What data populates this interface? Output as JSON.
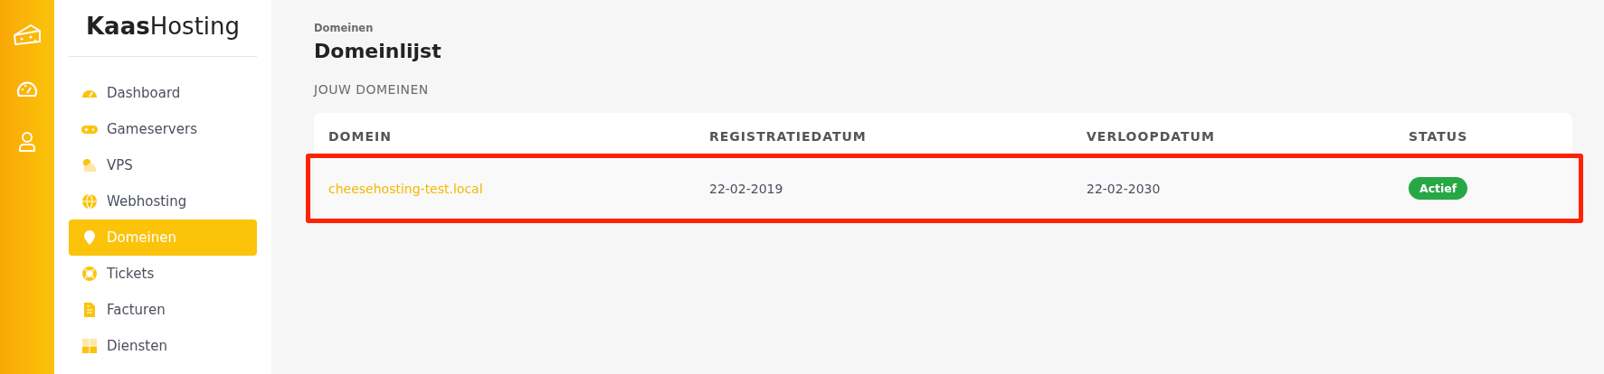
{
  "brand": {
    "bold": "Kaas",
    "light": "Hosting"
  },
  "rail": [
    {
      "kind": "cheese",
      "selected": false
    },
    {
      "kind": "gauge",
      "selected": false
    },
    {
      "kind": "user",
      "selected": false
    }
  ],
  "sidebar": {
    "items": [
      {
        "label": "Dashboard",
        "kind": "gauge",
        "selected": false
      },
      {
        "label": "Gameservers",
        "kind": "gamepad",
        "selected": false
      },
      {
        "label": "VPS",
        "kind": "cloud",
        "selected": false
      },
      {
        "label": "Webhosting",
        "kind": "globe",
        "selected": false
      },
      {
        "label": "Domeinen",
        "kind": "pin",
        "selected": true
      },
      {
        "label": "Tickets",
        "kind": "lifebuoy",
        "selected": false
      },
      {
        "label": "Facturen",
        "kind": "invoice",
        "selected": false
      },
      {
        "label": "Diensten",
        "kind": "grid",
        "selected": false
      }
    ]
  },
  "breadcrumb": "Domeinen",
  "title": "Domeinlijst",
  "section": "JOUW DOMEINEN",
  "table": {
    "columns": [
      "DOMEIN",
      "REGISTRATIEDATUM",
      "VERLOOPDATUM",
      "STATUS"
    ],
    "rows": [
      {
        "domain": "cheesehosting-test.local",
        "registered": "22-02-2019",
        "expires": "22-02-2030",
        "status": "Actief",
        "color": "#28a745",
        "highlighted": true
      }
    ]
  }
}
